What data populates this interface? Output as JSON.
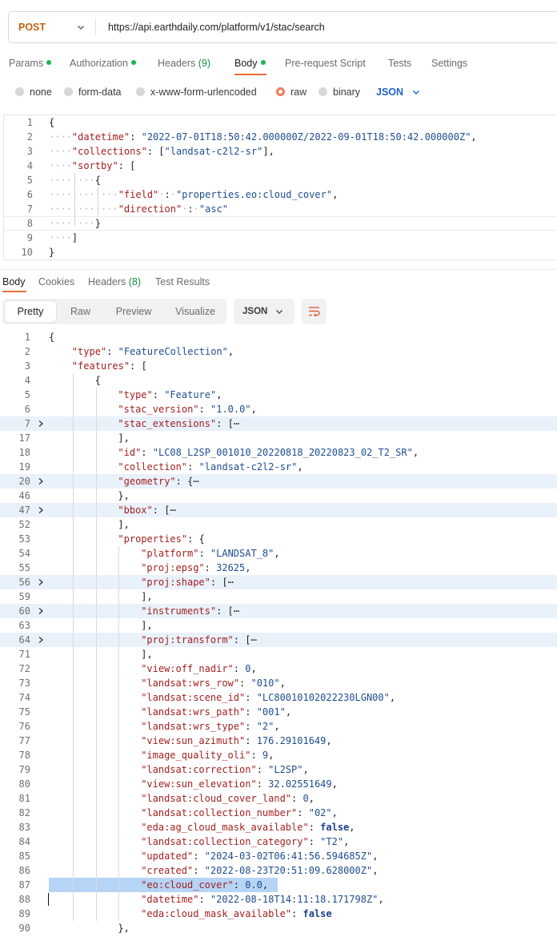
{
  "request": {
    "method": "POST",
    "url": "https://api.earthdaily.com/platform/v1/stac/search"
  },
  "request_tabs": [
    {
      "label": "Params",
      "dot": true,
      "count": ""
    },
    {
      "label": "Authorization",
      "dot": true,
      "count": ""
    },
    {
      "label": "Headers",
      "dot": false,
      "count": "(9)"
    },
    {
      "label": "Body",
      "dot": true,
      "count": "",
      "active": true
    },
    {
      "label": "Pre-request Script",
      "dot": false,
      "count": ""
    },
    {
      "label": "Tests",
      "dot": false,
      "count": ""
    },
    {
      "label": "Settings",
      "dot": false,
      "count": ""
    }
  ],
  "body_types": [
    {
      "label": "none",
      "selected": false
    },
    {
      "label": "form-data",
      "selected": false
    },
    {
      "label": "x-www-form-urlencoded",
      "selected": false
    },
    {
      "label": "raw",
      "selected": true
    },
    {
      "label": "binary",
      "selected": false
    }
  ],
  "body_format": "JSON",
  "request_body_lines": [
    {
      "n": "1",
      "ws": "",
      "parts": [
        [
          "p",
          "{"
        ]
      ]
    },
    {
      "n": "2",
      "ws": "····",
      "parts": [
        [
          "k",
          "\"datetime\""
        ],
        [
          "p",
          ": "
        ],
        [
          "s",
          "\"2022-07-01T18:50:42.000000Z/2022-09-01T18:50:42.000000Z\""
        ],
        [
          "p",
          ","
        ]
      ]
    },
    {
      "n": "3",
      "ws": "····",
      "parts": [
        [
          "k",
          "\"collections\""
        ],
        [
          "p",
          ": ["
        ],
        [
          "s",
          "\"landsat-c2l2-sr\""
        ],
        [
          "p",
          "],"
        ]
      ]
    },
    {
      "n": "4",
      "ws": "····",
      "parts": [
        [
          "k",
          "\"sortby\""
        ],
        [
          "p",
          ": ["
        ]
      ]
    },
    {
      "n": "5",
      "ws": "········",
      "parts": [
        [
          "p",
          "{"
        ]
      ]
    },
    {
      "n": "6",
      "ws": "············",
      "parts": [
        [
          "k",
          "\"field\""
        ],
        [
          "w",
          "·"
        ],
        [
          "p",
          ":"
        ],
        [
          "w",
          "·"
        ],
        [
          "s",
          "\"properties.eo:cloud_cover\""
        ],
        [
          "p",
          ","
        ]
      ]
    },
    {
      "n": "7",
      "ws": "············",
      "parts": [
        [
          "k",
          "\"direction\""
        ],
        [
          "w",
          "·"
        ],
        [
          "p",
          ":"
        ],
        [
          "w",
          "·"
        ],
        [
          "s",
          "\"asc\""
        ]
      ]
    },
    {
      "n": "8",
      "ws": "········",
      "parts": [
        [
          "p",
          "}"
        ]
      ]
    },
    {
      "n": "9",
      "ws": "····",
      "parts": [
        [
          "p",
          "]"
        ]
      ]
    },
    {
      "n": "10",
      "ws": "",
      "parts": [
        [
          "p",
          "}"
        ]
      ]
    }
  ],
  "response_tabs": [
    {
      "label": "Body",
      "count": "",
      "active": true
    },
    {
      "label": "Cookies",
      "count": ""
    },
    {
      "label": "Headers",
      "count": "(8)"
    },
    {
      "label": "Test Results",
      "count": ""
    }
  ],
  "view_modes": [
    "Pretty",
    "Raw",
    "Preview",
    "Visualize"
  ],
  "response_format": "JSON",
  "icons": {
    "wrap": "wrap-lines-icon",
    "caret": "chevron-down-icon",
    "fold": "chevron-right-icon"
  },
  "colors": {
    "accent": "#e86f3a",
    "key": "#a31f1f",
    "string": "#1e4d8f",
    "highlight": "#b6d4f5"
  },
  "response_lines": [
    {
      "n": "1",
      "indent": 0,
      "parts": [
        [
          "p",
          "{"
        ]
      ]
    },
    {
      "n": "2",
      "indent": 1,
      "parts": [
        [
          "k",
          "\"type\""
        ],
        [
          "p",
          ": "
        ],
        [
          "s",
          "\"FeatureCollection\""
        ],
        [
          "p",
          ","
        ]
      ]
    },
    {
      "n": "3",
      "indent": 1,
      "parts": [
        [
          "k",
          "\"features\""
        ],
        [
          "p",
          ": ["
        ]
      ]
    },
    {
      "n": "4",
      "indent": 2,
      "parts": [
        [
          "p",
          "{"
        ]
      ]
    },
    {
      "n": "5",
      "indent": 3,
      "parts": [
        [
          "k",
          "\"type\""
        ],
        [
          "p",
          ": "
        ],
        [
          "s",
          "\"Feature\""
        ],
        [
          "p",
          ","
        ]
      ]
    },
    {
      "n": "6",
      "indent": 3,
      "parts": [
        [
          "k",
          "\"stac_version\""
        ],
        [
          "p",
          ": "
        ],
        [
          "s",
          "\"1.0.0\""
        ],
        [
          "p",
          ","
        ]
      ]
    },
    {
      "n": "7",
      "indent": 3,
      "fold": true,
      "parts": [
        [
          "k",
          "\"stac_extensions\""
        ],
        [
          "p",
          ": ["
        ],
        [
          "e",
          "⋯"
        ]
      ]
    },
    {
      "n": "17",
      "indent": 3,
      "parts": [
        [
          "p",
          "],"
        ]
      ]
    },
    {
      "n": "18",
      "indent": 3,
      "parts": [
        [
          "k",
          "\"id\""
        ],
        [
          "p",
          ": "
        ],
        [
          "s",
          "\"LC08_L2SP_001010_20220818_20220823_02_T2_SR\""
        ],
        [
          "p",
          ","
        ]
      ]
    },
    {
      "n": "19",
      "indent": 3,
      "parts": [
        [
          "k",
          "\"collection\""
        ],
        [
          "p",
          ": "
        ],
        [
          "s",
          "\"landsat-c2l2-sr\""
        ],
        [
          "p",
          ","
        ]
      ]
    },
    {
      "n": "20",
      "indent": 3,
      "fold": true,
      "parts": [
        [
          "k",
          "\"geometry\""
        ],
        [
          "p",
          ": {"
        ],
        [
          "e",
          "⋯"
        ]
      ]
    },
    {
      "n": "46",
      "indent": 3,
      "parts": [
        [
          "p",
          "},"
        ]
      ]
    },
    {
      "n": "47",
      "indent": 3,
      "fold": true,
      "parts": [
        [
          "k",
          "\"bbox\""
        ],
        [
          "p",
          ": ["
        ],
        [
          "e",
          "⋯"
        ]
      ]
    },
    {
      "n": "52",
      "indent": 3,
      "parts": [
        [
          "p",
          "],"
        ]
      ]
    },
    {
      "n": "53",
      "indent": 3,
      "parts": [
        [
          "k",
          "\"properties\""
        ],
        [
          "p",
          ": {"
        ]
      ]
    },
    {
      "n": "54",
      "indent": 4,
      "parts": [
        [
          "k",
          "\"platform\""
        ],
        [
          "p",
          ": "
        ],
        [
          "s",
          "\"LANDSAT_8\""
        ],
        [
          "p",
          ","
        ]
      ]
    },
    {
      "n": "55",
      "indent": 4,
      "parts": [
        [
          "k",
          "\"proj:epsg\""
        ],
        [
          "p",
          ": "
        ],
        [
          "n",
          "32625"
        ],
        [
          "p",
          ","
        ]
      ]
    },
    {
      "n": "56",
      "indent": 4,
      "fold": true,
      "parts": [
        [
          "k",
          "\"proj:shape\""
        ],
        [
          "p",
          ": ["
        ],
        [
          "e",
          "⋯"
        ]
      ]
    },
    {
      "n": "59",
      "indent": 4,
      "parts": [
        [
          "p",
          "],"
        ]
      ]
    },
    {
      "n": "60",
      "indent": 4,
      "fold": true,
      "parts": [
        [
          "k",
          "\"instruments\""
        ],
        [
          "p",
          ": ["
        ],
        [
          "e",
          "⋯"
        ]
      ]
    },
    {
      "n": "63",
      "indent": 4,
      "parts": [
        [
          "p",
          "],"
        ]
      ]
    },
    {
      "n": "64",
      "indent": 4,
      "fold": true,
      "parts": [
        [
          "k",
          "\"proj:transform\""
        ],
        [
          "p",
          ": ["
        ],
        [
          "e",
          "⋯"
        ]
      ]
    },
    {
      "n": "71",
      "indent": 4,
      "parts": [
        [
          "p",
          "],"
        ]
      ]
    },
    {
      "n": "72",
      "indent": 4,
      "parts": [
        [
          "k",
          "\"view:off_nadir\""
        ],
        [
          "p",
          ": "
        ],
        [
          "n",
          "0"
        ],
        [
          "p",
          ","
        ]
      ]
    },
    {
      "n": "73",
      "indent": 4,
      "parts": [
        [
          "k",
          "\"landsat:wrs_row\""
        ],
        [
          "p",
          ": "
        ],
        [
          "s",
          "\"010\""
        ],
        [
          "p",
          ","
        ]
      ]
    },
    {
      "n": "74",
      "indent": 4,
      "parts": [
        [
          "k",
          "\"landsat:scene_id\""
        ],
        [
          "p",
          ": "
        ],
        [
          "s",
          "\"LC80010102022230LGN00\""
        ],
        [
          "p",
          ","
        ]
      ]
    },
    {
      "n": "75",
      "indent": 4,
      "parts": [
        [
          "k",
          "\"landsat:wrs_path\""
        ],
        [
          "p",
          ": "
        ],
        [
          "s",
          "\"001\""
        ],
        [
          "p",
          ","
        ]
      ]
    },
    {
      "n": "76",
      "indent": 4,
      "parts": [
        [
          "k",
          "\"landsat:wrs_type\""
        ],
        [
          "p",
          ": "
        ],
        [
          "s",
          "\"2\""
        ],
        [
          "p",
          ","
        ]
      ]
    },
    {
      "n": "77",
      "indent": 4,
      "parts": [
        [
          "k",
          "\"view:sun_azimuth\""
        ],
        [
          "p",
          ": "
        ],
        [
          "n",
          "176.29101649"
        ],
        [
          "p",
          ","
        ]
      ]
    },
    {
      "n": "78",
      "indent": 4,
      "parts": [
        [
          "k",
          "\"image_quality_oli\""
        ],
        [
          "p",
          ": "
        ],
        [
          "n",
          "9"
        ],
        [
          "p",
          ","
        ]
      ]
    },
    {
      "n": "79",
      "indent": 4,
      "parts": [
        [
          "k",
          "\"landsat:correction\""
        ],
        [
          "p",
          ": "
        ],
        [
          "s",
          "\"L2SP\""
        ],
        [
          "p",
          ","
        ]
      ]
    },
    {
      "n": "80",
      "indent": 4,
      "parts": [
        [
          "k",
          "\"view:sun_elevation\""
        ],
        [
          "p",
          ": "
        ],
        [
          "n",
          "32.02551649"
        ],
        [
          "p",
          ","
        ]
      ]
    },
    {
      "n": "81",
      "indent": 4,
      "parts": [
        [
          "k",
          "\"landsat:cloud_cover_land\""
        ],
        [
          "p",
          ": "
        ],
        [
          "n",
          "0"
        ],
        [
          "p",
          ","
        ]
      ]
    },
    {
      "n": "82",
      "indent": 4,
      "parts": [
        [
          "k",
          "\"landsat:collection_number\""
        ],
        [
          "p",
          ": "
        ],
        [
          "s",
          "\"02\""
        ],
        [
          "p",
          ","
        ]
      ]
    },
    {
      "n": "83",
      "indent": 4,
      "parts": [
        [
          "k",
          "\"eda:ag_cloud_mask_available\""
        ],
        [
          "p",
          ": "
        ],
        [
          "b",
          "false"
        ],
        [
          "p",
          ","
        ]
      ]
    },
    {
      "n": "84",
      "indent": 4,
      "parts": [
        [
          "k",
          "\"landsat:collection_category\""
        ],
        [
          "p",
          ": "
        ],
        [
          "s",
          "\"T2\""
        ],
        [
          "p",
          ","
        ]
      ]
    },
    {
      "n": "85",
      "indent": 4,
      "parts": [
        [
          "k",
          "\"updated\""
        ],
        [
          "p",
          ": "
        ],
        [
          "s",
          "\"2024-03-02T06:41:56.594685Z\""
        ],
        [
          "p",
          ","
        ]
      ]
    },
    {
      "n": "86",
      "indent": 4,
      "parts": [
        [
          "k",
          "\"created\""
        ],
        [
          "p",
          ": "
        ],
        [
          "s",
          "\"2022-08-23T20:51:09.628000Z\""
        ],
        [
          "p",
          ","
        ]
      ]
    },
    {
      "n": "87",
      "indent": 4,
      "highlight": true,
      "parts": [
        [
          "k",
          "\"eo:cloud_cover\""
        ],
        [
          "p",
          ": "
        ],
        [
          "n",
          "0.0"
        ],
        [
          "p",
          ","
        ]
      ]
    },
    {
      "n": "88",
      "indent": 4,
      "cursor": true,
      "parts": [
        [
          "k",
          "\"datetime\""
        ],
        [
          "p",
          ": "
        ],
        [
          "s",
          "\"2022-08-18T14:11:18.171798Z\""
        ],
        [
          "p",
          ","
        ]
      ]
    },
    {
      "n": "89",
      "indent": 4,
      "parts": [
        [
          "k",
          "\"eda:cloud_mask_available\""
        ],
        [
          "p",
          ": "
        ],
        [
          "b",
          "false"
        ]
      ]
    },
    {
      "n": "90",
      "indent": 3,
      "parts": [
        [
          "p",
          "},"
        ]
      ]
    }
  ]
}
